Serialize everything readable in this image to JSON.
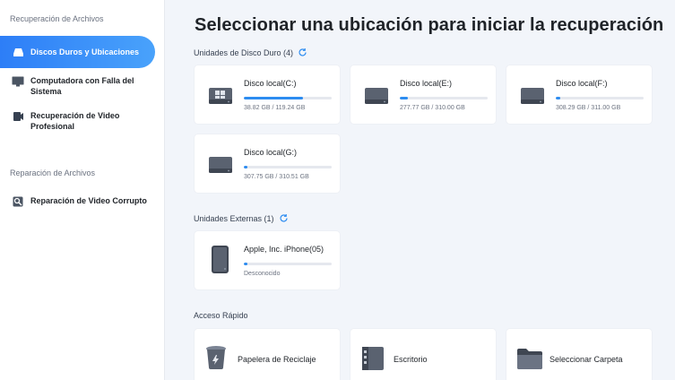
{
  "sidebar": {
    "section_recovery": "Recuperación de Archivos",
    "items": [
      {
        "label": "Discos Duros y Ubicaciones",
        "icon": "drive-icon",
        "active": true
      },
      {
        "label": "Computadora con Falla del Sistema",
        "icon": "monitor-icon",
        "active": false
      },
      {
        "label": "Recuperación de Video Profesional",
        "icon": "video-camera-icon",
        "active": false
      }
    ],
    "section_repair": "Reparación de Archivos",
    "repair_items": [
      {
        "label": "Reparación de Video Corrupto",
        "icon": "video-repair-icon"
      }
    ]
  },
  "main": {
    "title": "Seleccionar una ubicación para iniciar la recuperación",
    "hard_drives": {
      "label": "Unidades de Disco Duro (4)",
      "drives": [
        {
          "name": "Disco local(C:)",
          "size": "38.82 GB / 119.24 GB",
          "used_fraction": 0.67,
          "system": true
        },
        {
          "name": "Disco local(E:)",
          "size": "277.77 GB / 310.00 GB",
          "used_fraction": 0.09,
          "system": false
        },
        {
          "name": "Disco local(F:)",
          "size": "308.29 GB / 311.00 GB",
          "used_fraction": 0.05,
          "system": false
        },
        {
          "name": "Disco local(G:)",
          "size": "307.75 GB / 310.51 GB",
          "used_fraction": 0.04,
          "system": false
        }
      ]
    },
    "external": {
      "label": "Unidades Externas (1)",
      "devices": [
        {
          "name": "Apple, Inc. iPhone(05)",
          "size": "Desconocido",
          "used_fraction": 0.04
        }
      ]
    },
    "quick_access": {
      "label": "Acceso Rápido",
      "items": [
        {
          "label": "Papelera de Reciclaje",
          "icon": "recycle-bin-icon"
        },
        {
          "label": "Escritorio",
          "icon": "desktop-icon"
        },
        {
          "label": "Seleccionar Carpeta",
          "icon": "folder-icon"
        }
      ]
    }
  },
  "colors": {
    "accent": "#2d8cf0",
    "background": "#f2f5fa",
    "card": "#ffffff"
  }
}
